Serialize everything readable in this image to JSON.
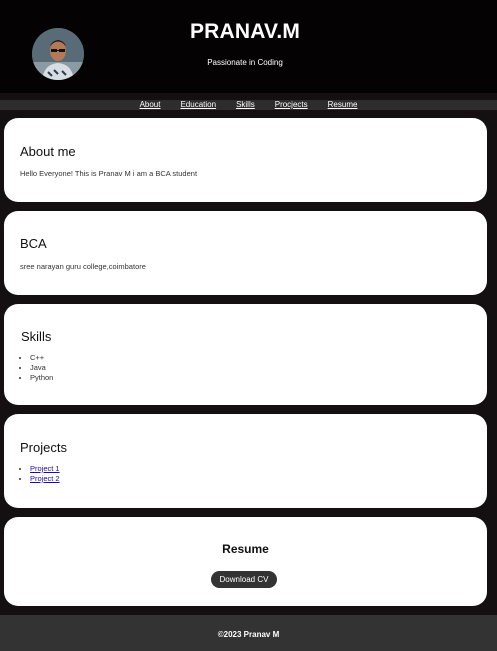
{
  "header": {
    "title": "PRANAV.M",
    "tagline": "Passionate in Coding",
    "avatar_icon": "profile-photo"
  },
  "nav": {
    "items": [
      "About",
      "Education",
      "Skills",
      "Procjects",
      "Resume"
    ]
  },
  "about": {
    "heading": "About me",
    "text": "Hello Everyone! This is Pranav M i am a BCA student"
  },
  "education": {
    "heading": "BCA",
    "text": "sree narayan guru college,coimbatore"
  },
  "skills": {
    "heading": "Skills",
    "items": [
      "C++",
      "Java",
      "Python"
    ]
  },
  "projects": {
    "heading": "Projects",
    "items": [
      "Project 1",
      "Project 2"
    ]
  },
  "resume": {
    "heading": "Resume",
    "button_label": "Download CV"
  },
  "footer": {
    "text": "©2023 Pranav M"
  },
  "colors": {
    "header_bg": "#050203",
    "page_bg": "#140f10",
    "nav_bg": "#2d2d2d",
    "card_bg": "#ffffff",
    "button_bg": "#333333",
    "footer_bg": "#333333",
    "link": "#1a0dab"
  }
}
